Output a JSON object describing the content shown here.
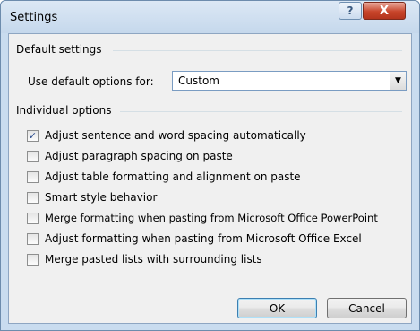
{
  "window": {
    "title": "Settings",
    "help_glyph": "?",
    "close_glyph": "X"
  },
  "default_settings": {
    "section_label": "Default settings",
    "use_default_label": "Use default options for:",
    "select_value": "Custom"
  },
  "individual_options": {
    "section_label": "Individual options",
    "items": [
      {
        "label": "Adjust sentence and word spacing automatically",
        "checked": true
      },
      {
        "label": "Adjust paragraph spacing on paste",
        "checked": false
      },
      {
        "label": "Adjust table formatting and alignment on paste",
        "checked": false
      },
      {
        "label": "Smart style behavior",
        "checked": false
      },
      {
        "label": "Merge formatting when pasting from Microsoft Office PowerPoint",
        "checked": false
      },
      {
        "label": "Adjust formatting when pasting from Microsoft Office Excel",
        "checked": false
      },
      {
        "label": "Merge pasted lists with surrounding lists",
        "checked": false
      }
    ]
  },
  "buttons": {
    "ok": "OK",
    "cancel": "Cancel"
  }
}
